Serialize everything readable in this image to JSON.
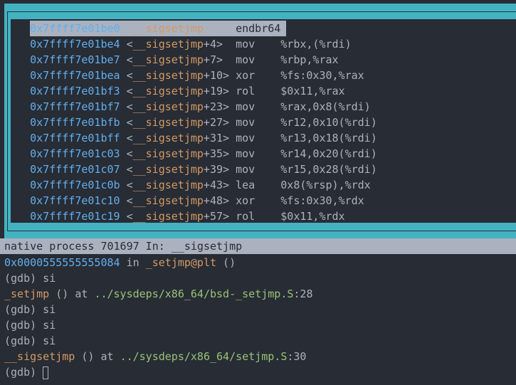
{
  "asm": {
    "rows": [
      {
        "marker": ">",
        "addr": "0x7ffff7e01be0",
        "sym_lt": "<",
        "sym": "__sigsetjmp",
        "off": "",
        "sym_gt": ">",
        "mn": "endbr64",
        "ops": ""
      },
      {
        "marker": "",
        "addr": "0x7ffff7e01be4",
        "sym_lt": "<",
        "sym": "__sigsetjmp",
        "off": "+4",
        "sym_gt": ">",
        "mn": "mov",
        "ops": "%rbx,(%rdi)"
      },
      {
        "marker": "",
        "addr": "0x7ffff7e01be7",
        "sym_lt": "<",
        "sym": "__sigsetjmp",
        "off": "+7",
        "sym_gt": ">",
        "mn": "mov",
        "ops": "%rbp,%rax"
      },
      {
        "marker": "",
        "addr": "0x7ffff7e01bea",
        "sym_lt": "<",
        "sym": "__sigsetjmp",
        "off": "+10",
        "sym_gt": ">",
        "mn": "xor",
        "ops": "%fs:0x30,%rax"
      },
      {
        "marker": "",
        "addr": "0x7ffff7e01bf3",
        "sym_lt": "<",
        "sym": "__sigsetjmp",
        "off": "+19",
        "sym_gt": ">",
        "mn": "rol",
        "ops": "$0x11,%rax"
      },
      {
        "marker": "",
        "addr": "0x7ffff7e01bf7",
        "sym_lt": "<",
        "sym": "__sigsetjmp",
        "off": "+23",
        "sym_gt": ">",
        "mn": "mov",
        "ops": "%rax,0x8(%rdi)"
      },
      {
        "marker": "",
        "addr": "0x7ffff7e01bfb",
        "sym_lt": "<",
        "sym": "__sigsetjmp",
        "off": "+27",
        "sym_gt": ">",
        "mn": "mov",
        "ops": "%r12,0x10(%rdi)"
      },
      {
        "marker": "",
        "addr": "0x7ffff7e01bff",
        "sym_lt": "<",
        "sym": "__sigsetjmp",
        "off": "+31",
        "sym_gt": ">",
        "mn": "mov",
        "ops": "%r13,0x18(%rdi)"
      },
      {
        "marker": "",
        "addr": "0x7ffff7e01c03",
        "sym_lt": "<",
        "sym": "__sigsetjmp",
        "off": "+35",
        "sym_gt": ">",
        "mn": "mov",
        "ops": "%r14,0x20(%rdi)"
      },
      {
        "marker": "",
        "addr": "0x7ffff7e01c07",
        "sym_lt": "<",
        "sym": "__sigsetjmp",
        "off": "+39",
        "sym_gt": ">",
        "mn": "mov",
        "ops": "%r15,0x28(%rdi)"
      },
      {
        "marker": "",
        "addr": "0x7ffff7e01c0b",
        "sym_lt": "<",
        "sym": "__sigsetjmp",
        "off": "+43",
        "sym_gt": ">",
        "mn": "lea",
        "ops": "0x8(%rsp),%rdx"
      },
      {
        "marker": "",
        "addr": "0x7ffff7e01c10",
        "sym_lt": "<",
        "sym": "__sigsetjmp",
        "off": "+48",
        "sym_gt": ">",
        "mn": "xor",
        "ops": "%fs:0x30,%rdx"
      },
      {
        "marker": "",
        "addr": "0x7ffff7e01c19",
        "sym_lt": "<",
        "sym": "__sigsetjmp",
        "off": "+57",
        "sym_gt": ">",
        "mn": "rol",
        "ops": "$0x11,%rdx"
      }
    ]
  },
  "status": "native process 701697 In: __sigsetjmp",
  "console": {
    "l1_addr": "0x0000555555555084",
    "l1_in": " in ",
    "l1_fn": "_setjmp@plt",
    "l1_rest": " ()",
    "l2": "(gdb) si",
    "l3_fn": "_setjmp",
    "l3_mid": " () at ",
    "l3_path": "../sysdeps/x86_64/bsd-_setjmp.S",
    "l3_line": ":28",
    "l4": "(gdb) si",
    "l5": "(gdb) si",
    "l6": "(gdb) si",
    "l7_fn": "__sigsetjmp",
    "l7_mid": " () at ",
    "l7_path": "../sysdeps/x86_64/setjmp.S",
    "l7_line": ":30",
    "prompt": "(gdb) "
  },
  "colors": {
    "teal": "#43b3c3",
    "address": "#61afef",
    "symbol": "#d19a66",
    "path": "#98c379"
  }
}
